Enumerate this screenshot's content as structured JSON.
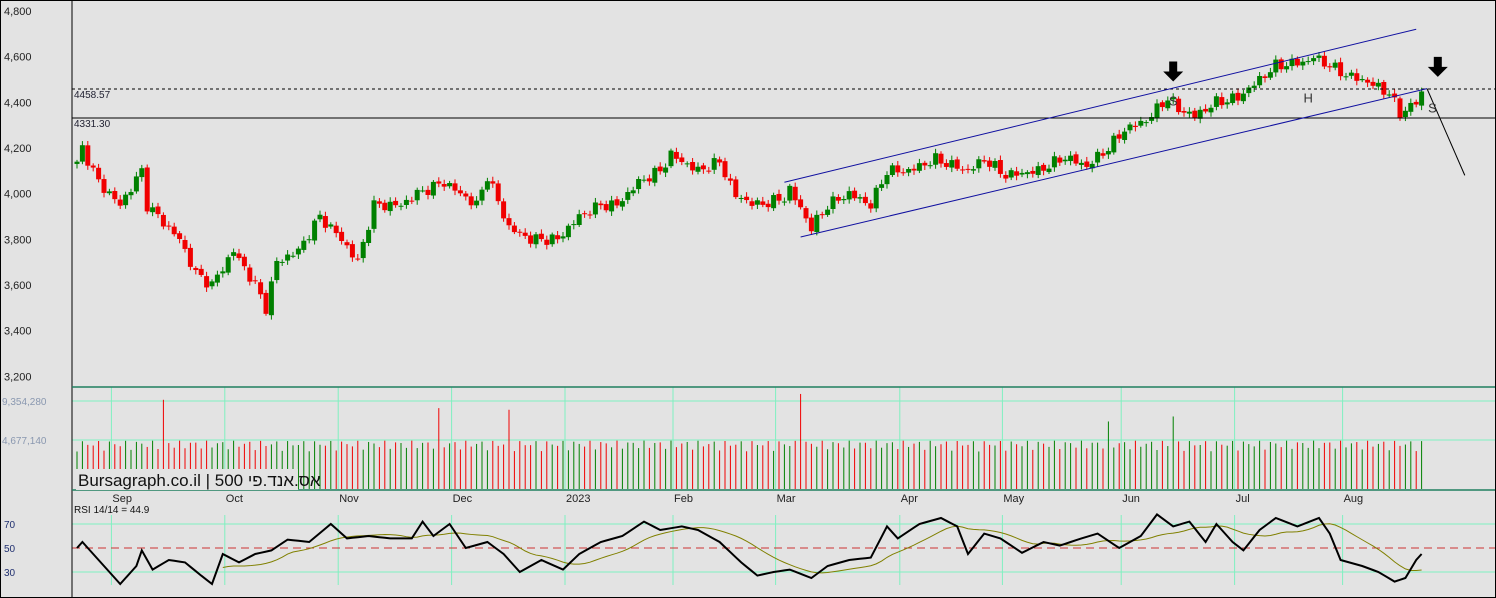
{
  "chart_data": {
    "type": "candlestick",
    "title": "Bursagraph.co.il | אס.אנד.פי 500",
    "brand": "Bursagraph.co.il",
    "separator": "|",
    "instrument": "אס.אנד.פי 500",
    "price_axis": {
      "ticks": [
        "4,800",
        "4,600",
        "4,400",
        "4,200",
        "4,000",
        "3,800",
        "3,600",
        "3,400",
        "3,200"
      ],
      "values": [
        4800,
        4600,
        4400,
        4200,
        4000,
        3800,
        3600,
        3400,
        3200
      ],
      "ylim": [
        3150,
        4850
      ]
    },
    "volume_axis": {
      "ticks": [
        "9,354,280",
        "4,677,140"
      ],
      "values": [
        9354280,
        4677140
      ]
    },
    "rsi": {
      "label": "RSI 14/14 = 44.9",
      "ticks": [
        "70",
        "50",
        "30"
      ],
      "values": [
        70,
        50,
        30
      ],
      "keypoints": [
        [
          0,
          50
        ],
        [
          1,
          55
        ],
        [
          3,
          45
        ],
        [
          6,
          30
        ],
        [
          8,
          20
        ],
        [
          11,
          35
        ],
        [
          12,
          48
        ],
        [
          14,
          32
        ],
        [
          17,
          40
        ],
        [
          20,
          38
        ],
        [
          23,
          27
        ],
        [
          25,
          20
        ],
        [
          27,
          45
        ],
        [
          30,
          38
        ],
        [
          33,
          45
        ],
        [
          36,
          48
        ],
        [
          39,
          57
        ],
        [
          43,
          55
        ],
        [
          47,
          70
        ],
        [
          50,
          58
        ],
        [
          54,
          60
        ],
        [
          58,
          58
        ],
        [
          62,
          58
        ],
        [
          64,
          72
        ],
        [
          66,
          60
        ],
        [
          69,
          70
        ],
        [
          72,
          50
        ],
        [
          76,
          55
        ],
        [
          79,
          45
        ],
        [
          82,
          30
        ],
        [
          86,
          40
        ],
        [
          90,
          32
        ],
        [
          93,
          45
        ],
        [
          97,
          55
        ],
        [
          101,
          60
        ],
        [
          105,
          72
        ],
        [
          108,
          65
        ],
        [
          112,
          68
        ],
        [
          115,
          65
        ],
        [
          119,
          55
        ],
        [
          123,
          38
        ],
        [
          126,
          27
        ],
        [
          129,
          30
        ],
        [
          132,
          32
        ],
        [
          136,
          25
        ],
        [
          139,
          35
        ],
        [
          143,
          40
        ],
        [
          147,
          42
        ],
        [
          150,
          68
        ],
        [
          152,
          58
        ],
        [
          156,
          70
        ],
        [
          160,
          75
        ],
        [
          163,
          68
        ],
        [
          165,
          45
        ],
        [
          168,
          62
        ],
        [
          171,
          58
        ],
        [
          175,
          46
        ],
        [
          179,
          55
        ],
        [
          182,
          52
        ],
        [
          186,
          58
        ],
        [
          189,
          62
        ],
        [
          193,
          50
        ],
        [
          197,
          60
        ],
        [
          200,
          78
        ],
        [
          203,
          68
        ],
        [
          206,
          72
        ],
        [
          209,
          55
        ],
        [
          211,
          70
        ],
        [
          214,
          55
        ],
        [
          216,
          48
        ],
        [
          219,
          65
        ],
        [
          222,
          75
        ],
        [
          226,
          68
        ],
        [
          230,
          75
        ],
        [
          232,
          62
        ],
        [
          234,
          40
        ],
        [
          238,
          35
        ],
        [
          241,
          30
        ],
        [
          244,
          22
        ],
        [
          246,
          25
        ],
        [
          248,
          40
        ],
        [
          249,
          45
        ]
      ]
    },
    "x_labels": [
      "Sep",
      "Oct",
      "Nov",
      "Dec",
      "2023",
      "Feb",
      "Mar",
      "Apr",
      "May",
      "Jun",
      "Jul",
      "Aug"
    ],
    "x_label_bars": [
      6,
      27,
      48,
      69,
      90,
      110,
      129,
      152,
      171,
      193,
      214,
      234
    ],
    "close_keypoints": [
      [
        0,
        4130
      ],
      [
        1,
        4200
      ],
      [
        4,
        4050
      ],
      [
        8,
        3950
      ],
      [
        12,
        4100
      ],
      [
        13,
        3950
      ],
      [
        19,
        3800
      ],
      [
        22,
        3650
      ],
      [
        25,
        3600
      ],
      [
        29,
        3750
      ],
      [
        33,
        3600
      ],
      [
        35,
        3500
      ],
      [
        37,
        3700
      ],
      [
        41,
        3750
      ],
      [
        45,
        3900
      ],
      [
        49,
        3800
      ],
      [
        52,
        3700
      ],
      [
        55,
        3950
      ],
      [
        60,
        3950
      ],
      [
        63,
        4000
      ],
      [
        68,
        4050
      ],
      [
        71,
        4000
      ],
      [
        74,
        3950
      ],
      [
        76,
        4080
      ],
      [
        80,
        3850
      ],
      [
        84,
        3800
      ],
      [
        89,
        3800
      ],
      [
        93,
        3900
      ],
      [
        97,
        3950
      ],
      [
        100,
        3950
      ],
      [
        104,
        4050
      ],
      [
        108,
        4100
      ],
      [
        110,
        4170
      ],
      [
        115,
        4100
      ],
      [
        119,
        4140
      ],
      [
        122,
        3990
      ],
      [
        126,
        3950
      ],
      [
        131,
        3980
      ],
      [
        132,
        4020
      ],
      [
        136,
        3850
      ],
      [
        139,
        3950
      ],
      [
        143,
        4000
      ],
      [
        147,
        3950
      ],
      [
        150,
        4100
      ],
      [
        154,
        4100
      ],
      [
        159,
        4150
      ],
      [
        165,
        4100
      ],
      [
        168,
        4150
      ],
      [
        172,
        4080
      ],
      [
        178,
        4100
      ],
      [
        183,
        4160
      ],
      [
        187,
        4120
      ],
      [
        191,
        4200
      ],
      [
        194,
        4280
      ],
      [
        198,
        4320
      ],
      [
        202,
        4420
      ],
      [
        204,
        4370
      ],
      [
        207,
        4340
      ],
      [
        211,
        4400
      ],
      [
        215,
        4420
      ],
      [
        218,
        4480
      ],
      [
        222,
        4560
      ],
      [
        228,
        4580
      ],
      [
        229,
        4600
      ],
      [
        232,
        4560
      ],
      [
        235,
        4520
      ],
      [
        239,
        4490
      ],
      [
        243,
        4440
      ],
      [
        245,
        4350
      ],
      [
        248,
        4400
      ],
      [
        249,
        4440
      ]
    ],
    "levels": [
      {
        "label": "4458.57",
        "value": 4458.57,
        "style": "dashed"
      },
      {
        "label": "4331.30",
        "value": 4331.3,
        "style": "solid"
      }
    ],
    "trendlines": [
      {
        "from": [
          131,
          4050
        ],
        "to": [
          248,
          4720
        ]
      },
      {
        "from": [
          134,
          3810
        ],
        "to": [
          250,
          4460
        ]
      },
      {
        "from": [
          250,
          4460
        ],
        "to": [
          257,
          4080
        ]
      }
    ],
    "annotations": [
      {
        "text": "S",
        "bar": 203,
        "price": 4385
      },
      {
        "text": "H",
        "bar": 228,
        "price": 4400
      },
      {
        "text": "S",
        "bar": 251,
        "price": 4355
      }
    ],
    "arrows": [
      {
        "bar": 203,
        "price": 4500
      },
      {
        "bar": 252,
        "price": 4520
      }
    ]
  }
}
